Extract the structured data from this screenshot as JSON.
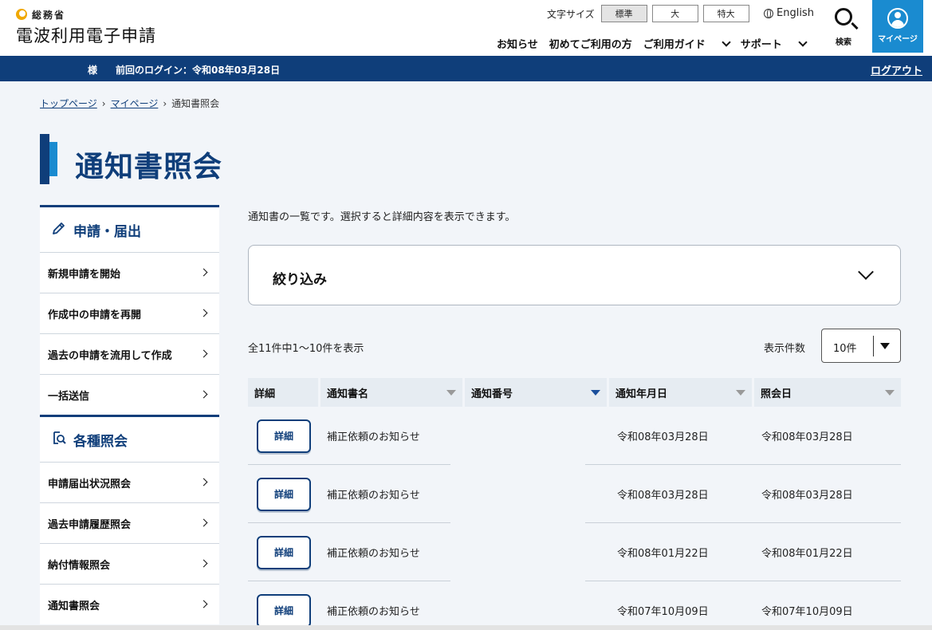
{
  "header": {
    "ministry": "総務省",
    "site_title": "電波利用電子申請",
    "font_size_label": "文字サイズ",
    "font_sizes": [
      "標準",
      "大",
      "特大"
    ],
    "language": "English",
    "nav": [
      "お知らせ",
      "初めてご利用の方",
      "ご利用ガイド",
      "サポート"
    ],
    "search_label": "検索",
    "mypage_label": "マイページ"
  },
  "userbar": {
    "honorific": "様",
    "last_login": "前回のログイン：令和08年03月28日",
    "logout": "ログアウト"
  },
  "breadcrumb": [
    "トップページ",
    "マイページ",
    "通知書照会"
  ],
  "page_title": "通知書照会",
  "sidebar": {
    "section1": {
      "title": "申請・届出",
      "items": [
        "新規申請を開始",
        "作成中の申請を再開",
        "過去の申請を流用して作成",
        "一括送信"
      ]
    },
    "section2": {
      "title": "各種照会",
      "items": [
        "申請届出状況照会",
        "過去申請履歴照会",
        "納付情報照会",
        "通知書照会"
      ]
    }
  },
  "main": {
    "intro": "通知書の一覧です。選択すると詳細内容を表示できます。",
    "filter_label": "絞り込み",
    "count_text": "全11件中1～10件を表示",
    "per_page_label": "表示件数",
    "per_page_value": "10件",
    "columns": [
      "詳細",
      "通知書名",
      "通知番号",
      "通知年月日",
      "照会日"
    ],
    "detail_label": "詳細",
    "rows": [
      {
        "name": "補正依頼のお知らせ",
        "number": "",
        "date": "令和08年03月28日",
        "viewed": "令和08年03月28日"
      },
      {
        "name": "補正依頼のお知らせ",
        "number": "",
        "date": "令和08年03月28日",
        "viewed": "令和08年03月28日"
      },
      {
        "name": "補正依頼のお知らせ",
        "number": "",
        "date": "令和08年01月22日",
        "viewed": "令和08年01月22日"
      },
      {
        "name": "補正依頼のお知らせ",
        "number": "",
        "date": "令和07年10月09日",
        "viewed": "令和07年10月09日"
      }
    ]
  },
  "colors": {
    "navy": "#0f3e7a",
    "accent_blue": "#1a8bd0",
    "page_bg": "#f2f5f9"
  }
}
